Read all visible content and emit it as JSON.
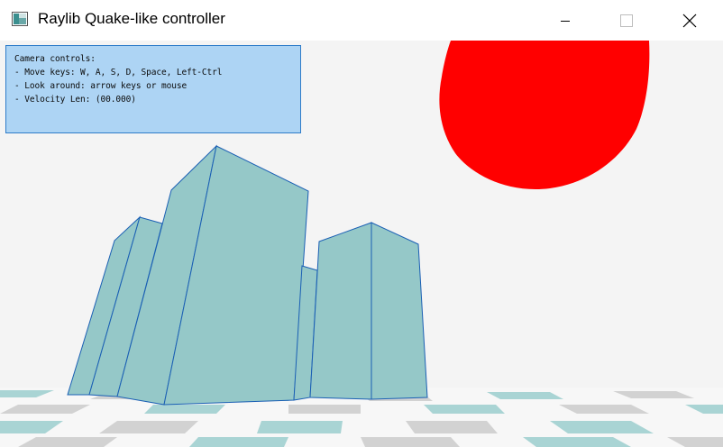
{
  "window": {
    "title": "Raylib Quake-like controller",
    "icon": "raylib-app-icon",
    "controls": [
      "minimize-icon",
      "maximize-icon",
      "close-icon"
    ]
  },
  "scene": {
    "background_color": "#f4f4f4",
    "sun_color": "#ff0000",
    "building_fill": "#95c8c8",
    "building_edge": "#1a5fb4",
    "floor_tile_colors": [
      "#d2d2d2",
      "#a9d4d4",
      "#f7f7f7"
    ]
  },
  "info_panel": {
    "heading": "Camera controls:",
    "move": "- Move keys: W, A, S, D, Space, Left-Ctrl",
    "look": "- Look around: arrow keys or mouse",
    "velocity": "- Velocity Len: (00.000)"
  }
}
